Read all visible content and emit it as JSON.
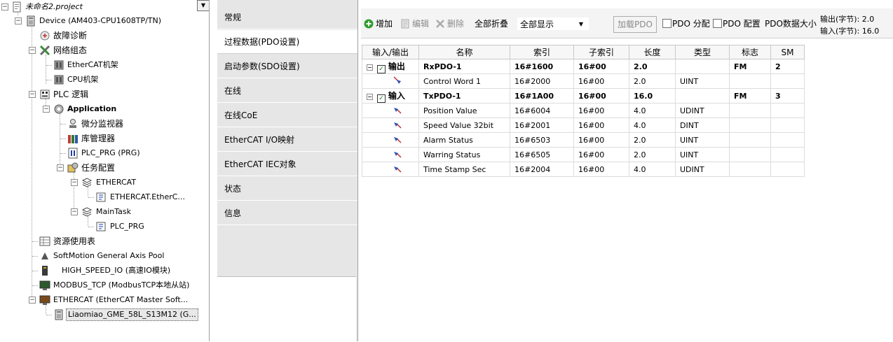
{
  "tree": {
    "items": [
      {
        "label": "未命名2.project",
        "icon": "project-icon",
        "expander": "−"
      },
      {
        "label": "Device (AM403-CPU1608TP/TN)",
        "icon": "device-icon",
        "expander": "−"
      },
      {
        "label": "故障诊断",
        "icon": "diagnosis-icon",
        "expander": ""
      },
      {
        "label": "网络组态",
        "icon": "network-config-icon",
        "expander": "−"
      },
      {
        "label": "EtherCAT机架",
        "icon": "rack-icon",
        "expander": ""
      },
      {
        "label": "CPU机架",
        "icon": "rack-icon",
        "expander": ""
      },
      {
        "label": "PLC 逻辑",
        "icon": "plc-logic-icon",
        "expander": "−"
      },
      {
        "label": "Application",
        "icon": "application-gear-icon",
        "expander": "−"
      },
      {
        "label": "微分监视器",
        "icon": "monitor-icon",
        "expander": ""
      },
      {
        "label": "库管理器",
        "icon": "library-icon",
        "expander": ""
      },
      {
        "label": "PLC_PRG (PRG)",
        "icon": "program-icon",
        "expander": ""
      },
      {
        "label": "任务配置",
        "icon": "task-config-icon",
        "expander": "−"
      },
      {
        "label": "ETHERCAT",
        "icon": "task-icon",
        "expander": "−"
      },
      {
        "label": "ETHERCAT.EtherC...",
        "icon": "task-call-icon",
        "expander": ""
      },
      {
        "label": "MainTask",
        "icon": "task-icon",
        "expander": "−"
      },
      {
        "label": "PLC_PRG",
        "icon": "task-call-icon",
        "expander": ""
      },
      {
        "label": "资源使用表",
        "icon": "table-icon",
        "expander": ""
      },
      {
        "label": "SoftMotion General Axis Pool",
        "icon": "axis-pool-icon",
        "expander": ""
      },
      {
        "label": "HIGH_SPEED_IO (高速IO模块)",
        "icon": "io-module-icon",
        "expander": ""
      },
      {
        "label": "MODBUS_TCP (ModbusTCP本地从站)",
        "icon": "modbus-icon",
        "expander": ""
      },
      {
        "label": "ETHERCAT (EtherCAT Master Soft...",
        "icon": "ethercat-master-icon",
        "expander": "−"
      },
      {
        "label": "Liaomiao_GME_58L_S13M12 (G...",
        "icon": "encoder-device-icon",
        "expander": ""
      }
    ],
    "dropdown_icon": "dropdown-arrow-icon"
  },
  "tabs": [
    {
      "label": "常规"
    },
    {
      "label": "过程数据(PDO设置)"
    },
    {
      "label": "启动参数(SDO设置)"
    },
    {
      "label": "在线"
    },
    {
      "label": "在线CoE"
    },
    {
      "label": "EtherCAT I/O映射"
    },
    {
      "label": "EtherCAT IEC对象"
    },
    {
      "label": "状态"
    },
    {
      "label": "信息"
    }
  ],
  "toolbar": {
    "add": "增加",
    "edit": "编辑",
    "delete": "删除",
    "collapse_all": "全部折叠",
    "view_selected": "全部显示",
    "load_pdo": "加载PDO",
    "pdo_assign": "PDO 分配",
    "pdo_config": "PDO 配置",
    "pdo_size_label": "PDO数据大小",
    "output_bytes": "输出(字节): 2.0",
    "input_bytes": "输入(字节): 16.0"
  },
  "table": {
    "headers": [
      "输入/输出",
      "名称",
      "索引",
      "子索引",
      "长度",
      "类型",
      "标志",
      "SM"
    ],
    "rows": [
      {
        "group": true,
        "io": "输出",
        "name": "RxPDO-1",
        "index": "16#1600",
        "subindex": "16#00",
        "length": "2.0",
        "type": "",
        "flag": "FM",
        "sm": "2",
        "checked": "✓"
      },
      {
        "group": false,
        "io": "",
        "name": "Control Word 1",
        "index": "16#2000",
        "subindex": "16#00",
        "length": "2.0",
        "type": "UINT",
        "flag": "",
        "sm": "",
        "icon": "output-entry-icon"
      },
      {
        "group": true,
        "io": "输入",
        "name": "TxPDO-1",
        "index": "16#1A00",
        "subindex": "16#00",
        "length": "16.0",
        "type": "",
        "flag": "FM",
        "sm": "3",
        "checked": "✓"
      },
      {
        "group": false,
        "io": "",
        "name": "Position Value",
        "index": "16#6004",
        "subindex": "16#00",
        "length": "4.0",
        "type": "UDINT",
        "flag": "",
        "sm": "",
        "icon": "input-entry-icon"
      },
      {
        "group": false,
        "io": "",
        "name": "Speed Value 32bit",
        "index": "16#2001",
        "subindex": "16#00",
        "length": "4.0",
        "type": "DINT",
        "flag": "",
        "sm": "",
        "icon": "input-entry-icon"
      },
      {
        "group": false,
        "io": "",
        "name": "Alarm Status",
        "index": "16#6503",
        "subindex": "16#00",
        "length": "2.0",
        "type": "UINT",
        "flag": "",
        "sm": "",
        "icon": "input-entry-icon"
      },
      {
        "group": false,
        "io": "",
        "name": "Warring Status",
        "index": "16#6505",
        "subindex": "16#00",
        "length": "2.0",
        "type": "UINT",
        "flag": "",
        "sm": "",
        "icon": "input-entry-icon"
      },
      {
        "group": false,
        "io": "",
        "name": "Time Stamp Sec",
        "index": "16#2004",
        "subindex": "16#00",
        "length": "4.0",
        "type": "UDINT",
        "flag": "",
        "sm": "",
        "icon": "input-entry-icon"
      }
    ]
  }
}
